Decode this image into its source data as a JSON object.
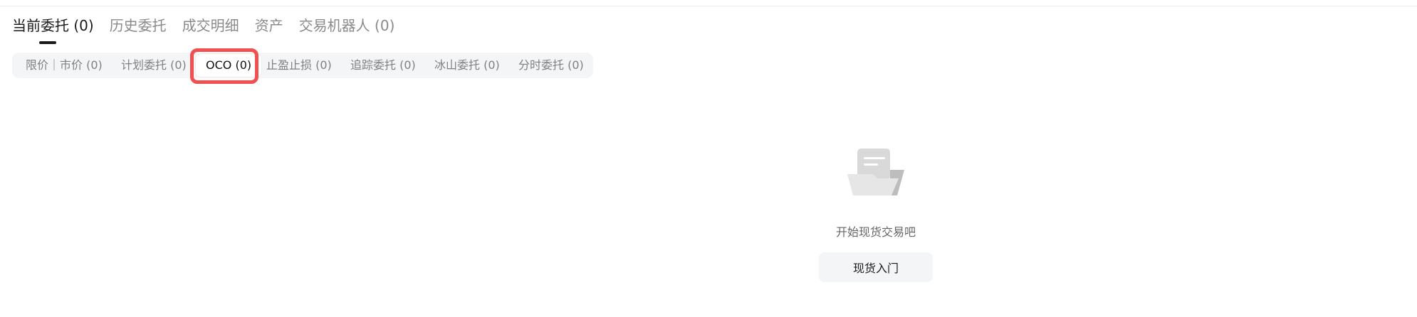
{
  "main_tabs": [
    {
      "label": "当前委托 (0)",
      "active": true
    },
    {
      "label": "历史委托",
      "active": false
    },
    {
      "label": "成交明细",
      "active": false
    },
    {
      "label": "资产",
      "active": false
    },
    {
      "label": "交易机器人 (0)",
      "active": false
    }
  ],
  "sub_tabs": [
    {
      "label": "限价｜市价 (0)",
      "active": false
    },
    {
      "label": "计划委托 (0)",
      "active": false
    },
    {
      "label": "OCO (0)",
      "active": true
    },
    {
      "label": "止盈止损 (0)",
      "active": false
    },
    {
      "label": "追踪委托 (0)",
      "active": false
    },
    {
      "label": "冰山委托 (0)",
      "active": false
    },
    {
      "label": "分时委托 (0)",
      "active": false
    }
  ],
  "empty_state": {
    "message": "开始现货交易吧",
    "button_label": "现货入门"
  },
  "colors": {
    "highlight": "#f05050",
    "active_text": "#1a1a1a",
    "inactive_text": "#8a8a8a",
    "pill_bg": "#f4f5f6"
  },
  "icons": {
    "empty": "empty-folder-document-icon"
  }
}
